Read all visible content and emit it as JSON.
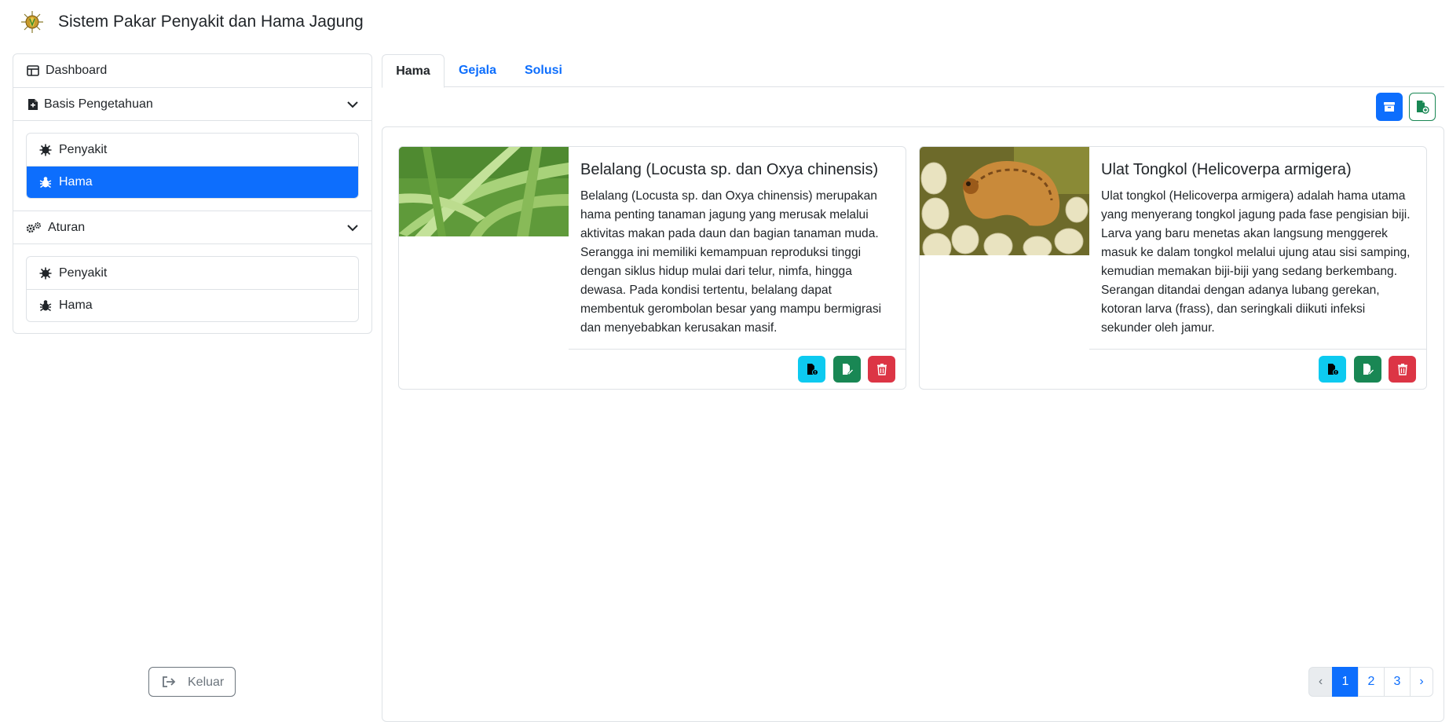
{
  "app": {
    "title": "Sistem Pakar Penyakit dan Hama Jagung"
  },
  "sidebar": {
    "dashboard_label": "Dashboard",
    "sections": [
      {
        "label": "Basis Pengetahuan",
        "items": [
          {
            "label": "Penyakit",
            "icon": "virus-icon",
            "active": false
          },
          {
            "label": "Hama",
            "icon": "bug-icon",
            "active": true
          }
        ]
      },
      {
        "label": "Aturan",
        "items": [
          {
            "label": "Penyakit",
            "icon": "virus-icon",
            "active": false
          },
          {
            "label": "Hama",
            "icon": "bug-icon",
            "active": false
          }
        ]
      }
    ],
    "logout_label": "Keluar"
  },
  "tabs": [
    {
      "label": "Hama",
      "active": true
    },
    {
      "label": "Gejala",
      "active": false
    },
    {
      "label": "Solusi",
      "active": false
    }
  ],
  "cards": [
    {
      "title": "Belalang (Locusta sp. dan Oxya chinensis)",
      "description": "Belalang (Locusta sp. dan Oxya chinensis) merupakan hama penting tanaman jagung yang merusak melalui aktivitas makan pada daun dan bagian tanaman muda. Serangga ini memiliki kemampuan reproduksi tinggi dengan siklus hidup mulai dari telur, nimfa, hingga dewasa. Pada kondisi tertentu, belalang dapat membentuk gerombolan besar yang mampu bermigrasi dan menyebabkan kerusakan masif."
    },
    {
      "title": "Ulat Tongkol (Helicoverpa armigera)",
      "description": "Ulat tongkol (Helicoverpa armigera) adalah hama utama yang menyerang tongkol jagung pada fase pengisian biji. Larva yang baru menetas akan langsung menggerek masuk ke dalam tongkol melalui ujung atau sisi samping, kemudian memakan biji-biji yang sedang berkembang. Serangan ditandai dengan adanya lubang gerekan, kotoran larva (frass), dan seringkali diikuti infeksi sekunder oleh jamur."
    }
  ],
  "pagination": {
    "prev": "‹",
    "pages": [
      "1",
      "2",
      "3"
    ],
    "current": "1",
    "next": "›"
  },
  "colors": {
    "primary": "#0d6efd",
    "info": "#0dcaf0",
    "success": "#198754",
    "danger": "#dc3545",
    "border": "#dee2e6"
  }
}
